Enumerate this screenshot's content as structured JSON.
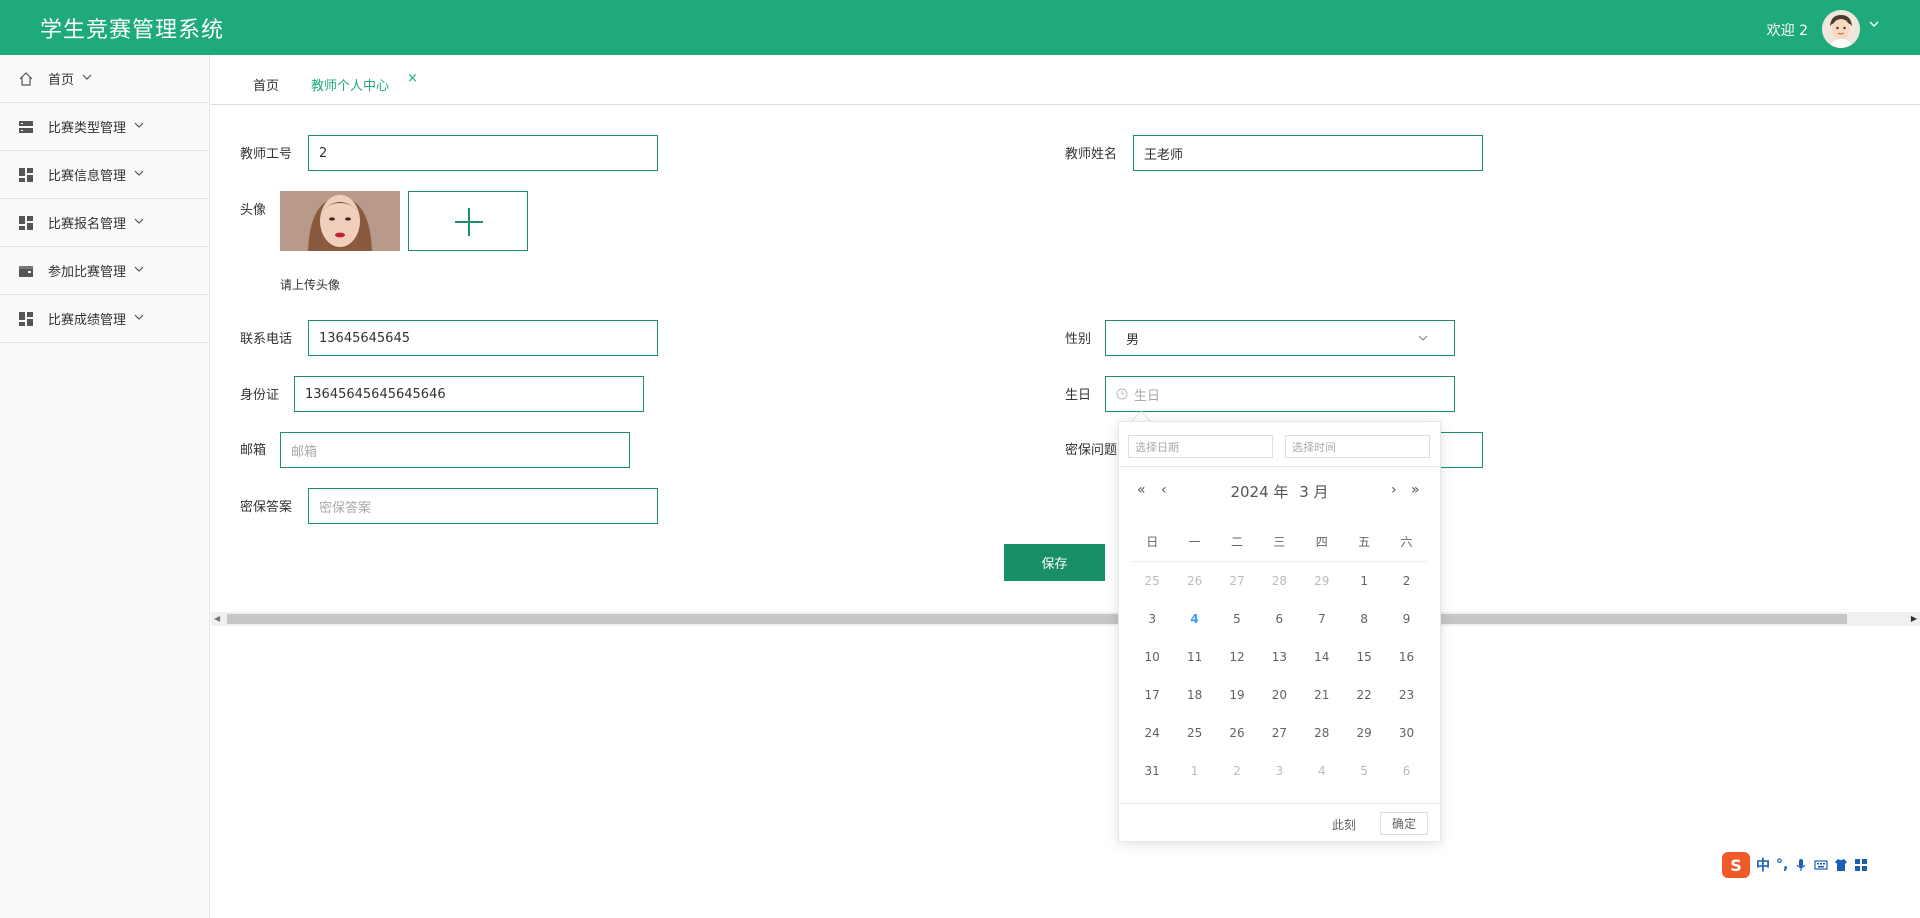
{
  "header": {
    "title": "学生竞赛管理系统",
    "welcome": "欢迎 2",
    "caret": "⌄"
  },
  "sidebar": {
    "items": [
      {
        "label": "首页",
        "icon": "home-icon"
      },
      {
        "label": "比赛类型管理",
        "icon": "server-icon"
      },
      {
        "label": "比赛信息管理",
        "icon": "dashboard-icon"
      },
      {
        "label": "比赛报名管理",
        "icon": "dashboard-icon"
      },
      {
        "label": "参加比赛管理",
        "icon": "wallet-icon"
      },
      {
        "label": "比赛成绩管理",
        "icon": "dashboard-icon"
      }
    ]
  },
  "tabs": {
    "home": "首页",
    "active": "教师个人中心",
    "close": "×"
  },
  "form": {
    "teacher_id": {
      "label": "教师工号",
      "value": "2"
    },
    "teacher_name": {
      "label": "教师姓名",
      "value": "王老师"
    },
    "avatar": {
      "label": "头像",
      "hint": "请上传头像"
    },
    "phone": {
      "label": "联系电话",
      "value": "13645645645"
    },
    "gender": {
      "label": "性别",
      "value": "男"
    },
    "id_card": {
      "label": "身份证",
      "value": "13645645645645646"
    },
    "birthday": {
      "label": "生日",
      "placeholder": "生日"
    },
    "email": {
      "label": "邮箱",
      "placeholder": "邮箱"
    },
    "security_question": {
      "label": "密保问题"
    },
    "security_answer": {
      "label": "密保答案",
      "placeholder": "密保答案"
    },
    "save_label": "保存"
  },
  "date_picker": {
    "date_placeholder": "选择日期",
    "time_placeholder": "选择时间",
    "year_label": "2024 年",
    "month_label": "3 月",
    "weekdays": [
      "日",
      "一",
      "二",
      "三",
      "四",
      "五",
      "六"
    ],
    "weeks": [
      [
        "25",
        "26",
        "27",
        "28",
        "29",
        "1",
        "2"
      ],
      [
        "3",
        "4",
        "5",
        "6",
        "7",
        "8",
        "9"
      ],
      [
        "10",
        "11",
        "12",
        "13",
        "14",
        "15",
        "16"
      ],
      [
        "17",
        "18",
        "19",
        "20",
        "21",
        "22",
        "23"
      ],
      [
        "24",
        "25",
        "26",
        "27",
        "28",
        "29",
        "30"
      ],
      [
        "31",
        "1",
        "2",
        "3",
        "4",
        "5",
        "6"
      ]
    ],
    "now_label": "此刻",
    "confirm_label": "确定"
  },
  "ime": {
    "lang": "中",
    "punct": "°,"
  },
  "colors": {
    "brand": "#1eaa7b",
    "save_button": "#188f68",
    "today": "#409eff"
  }
}
